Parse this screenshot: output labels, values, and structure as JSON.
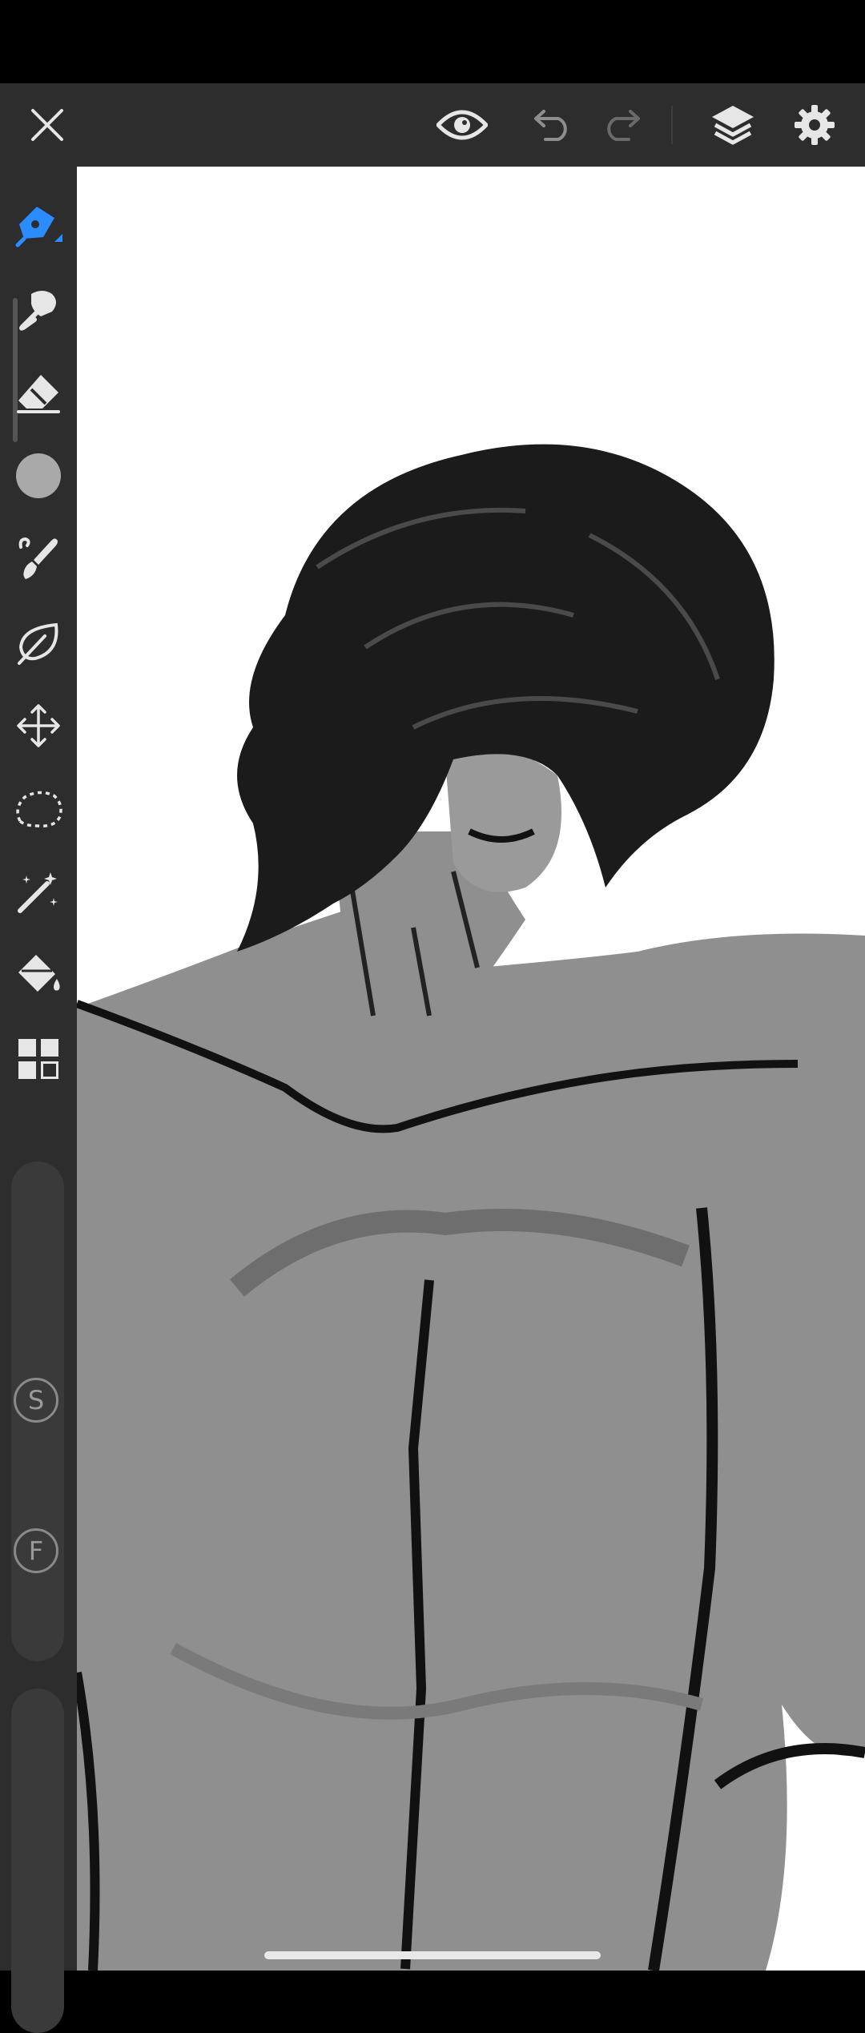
{
  "top_toolbar": {
    "buttons": [
      "close",
      "preview",
      "undo",
      "redo",
      "layers",
      "settings"
    ]
  },
  "left_toolbar": {
    "tools": [
      "pen",
      "smudge",
      "eraser",
      "brush-size",
      "brush-library",
      "stabilizer-shape",
      "transform",
      "lasso-select",
      "magic-wand",
      "fill",
      "more-tools"
    ],
    "active_tool": "pen"
  },
  "sliders": {
    "size_label": "S",
    "flow_label": "F"
  },
  "colors": {
    "accent": "#2b8cff",
    "toolbar_bg": "#2d2d2d",
    "icon": "#e6e6e6"
  }
}
